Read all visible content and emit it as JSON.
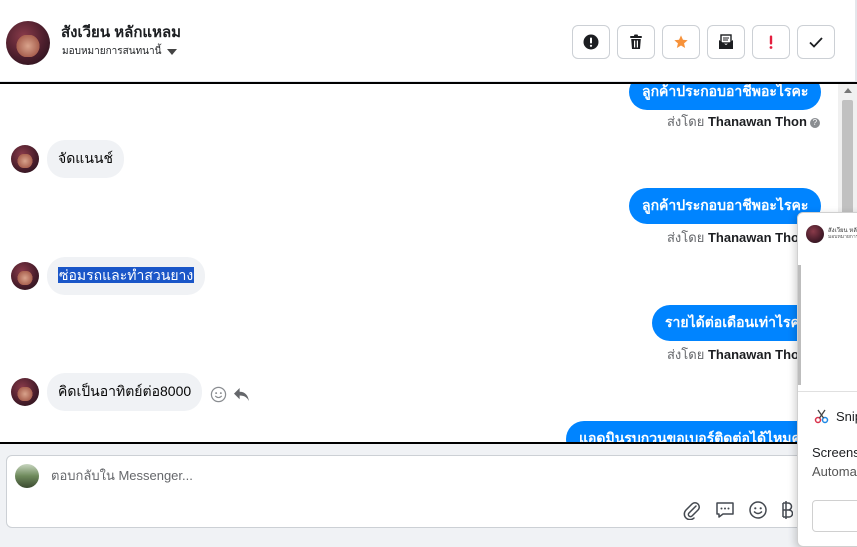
{
  "header": {
    "contact_name": "สังเวียน หลักแหลม",
    "assignee_label": "มอบหมายการสนทนานี้",
    "toolbar": [
      {
        "name": "spam-button",
        "icon": "exclamation-circle-icon"
      },
      {
        "name": "delete-button",
        "icon": "trash-icon"
      },
      {
        "name": "star-button",
        "icon": "star-icon"
      },
      {
        "name": "mark-unread-button",
        "icon": "envelope-icon"
      },
      {
        "name": "priority-button",
        "icon": "exclamation-icon"
      },
      {
        "name": "done-button",
        "icon": "check-icon"
      }
    ]
  },
  "messages": [
    {
      "type": "outgoing",
      "text": "ลูกค้าประกอบอาชีพอะไรคะ",
      "sent_by_prefix": "ส่งโดย",
      "sent_by_name": "Thanawan Thon"
    },
    {
      "type": "incoming",
      "text": "จัดแนนช์"
    },
    {
      "type": "outgoing",
      "text": "ลูกค้าประกอบอาชีพอะไรคะ",
      "sent_by_prefix": "ส่งโดย",
      "sent_by_name": "Thanawan Thon"
    },
    {
      "type": "incoming",
      "text": "ซ่อมรถและทำสวนยาง",
      "selected": true
    },
    {
      "type": "outgoing",
      "text": "รายได้ต่อเดือนเท่าไรคะ",
      "sent_by_prefix": "ส่งโดย",
      "sent_by_name": "Thanawan Thon"
    },
    {
      "type": "incoming",
      "text": "คิดเป็นอาทิตย์ต่อ8000"
    },
    {
      "type": "outgoing",
      "text": "แอดมินรบกวนขอเบอร์ติดต่อได้ไหมคะ"
    }
  ],
  "composer": {
    "placeholder": "ตอบกลับใน Messenger..."
  },
  "popup": {
    "sender": "สังเวียน หลักแหลม",
    "subtitle": "มอบหมายการสนทนานี้",
    "app_name": "Snip",
    "line1": "Screens",
    "line2": "Automa"
  },
  "colors": {
    "accent": "#0084ff",
    "star": "#f7923a",
    "priority": "#e41e3f",
    "incoming_bubble": "#f0f2f5",
    "selection": "#1a56c8"
  }
}
